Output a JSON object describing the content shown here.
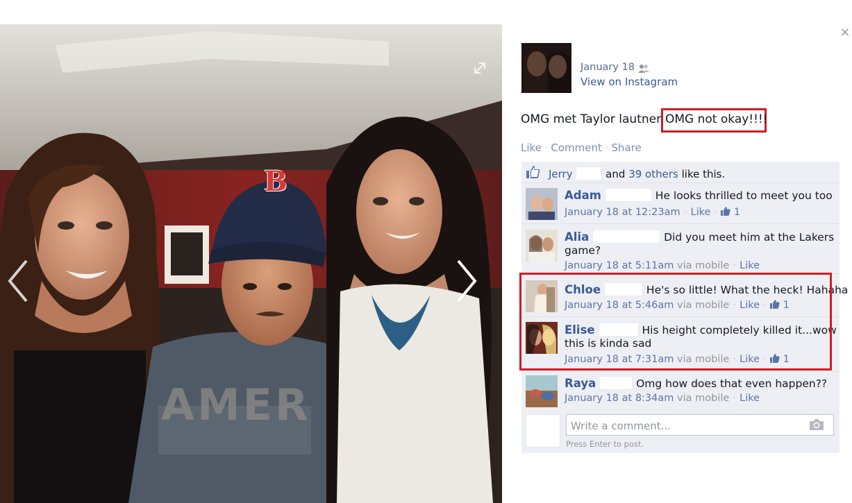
{
  "post": {
    "date": "January 18",
    "audience_icon": "friends-icon",
    "view_link": "View on Instagram",
    "caption_main": "OMG met Taylor lautner",
    "caption_highlight": "OMG not okay!!!!",
    "actions": {
      "like": "Like",
      "comment": "Comment",
      "share": "Share"
    }
  },
  "photo": {
    "cap_letter": "B",
    "shirt_text": "AMER",
    "expand_icon": "expand-icon",
    "prev_icon": "chevron-left-icon",
    "next_icon": "chevron-right-icon"
  },
  "close_label": "×",
  "likes": {
    "name": "Jerry",
    "and_text": "and",
    "others_link": "39 others",
    "suffix": "like this."
  },
  "comments": [
    {
      "name": "Adam",
      "text": "He looks thrilled to meet you too",
      "text2": "",
      "time": "January 18 at 12:23am",
      "via": "",
      "like": "Like",
      "likes": "1"
    },
    {
      "name": "Alia",
      "text": "Did you meet him at the Lakers",
      "text2": "game?",
      "time": "January 18 at 5:11am",
      "via": "via mobile",
      "like": "Like",
      "likes": ""
    },
    {
      "name": "Chloe",
      "text": "He's so little! What the heck! Hahaha",
      "text2": "",
      "time": "January 18 at 5:46am",
      "via": "via mobile",
      "like": "Like",
      "likes": "1"
    },
    {
      "name": "Elise",
      "text": "His height completely killed it...wow",
      "text2": "this is kinda sad",
      "time": "January 18 at 7:31am",
      "via": "via mobile",
      "like": "Like",
      "likes": "1"
    },
    {
      "name": "Raya",
      "text": "Omg how does that even happen??",
      "text2": "",
      "time": "January 18 at 8:34am",
      "via": "via mobile",
      "like": "Like",
      "likes": ""
    }
  ],
  "composer": {
    "placeholder": "Write a comment...",
    "hint": "Press Enter to post.",
    "camera_icon": "camera-icon"
  },
  "colors": {
    "link": "#3b5998",
    "highlight": "#d01b23",
    "ufi_bg": "#edeff4"
  }
}
